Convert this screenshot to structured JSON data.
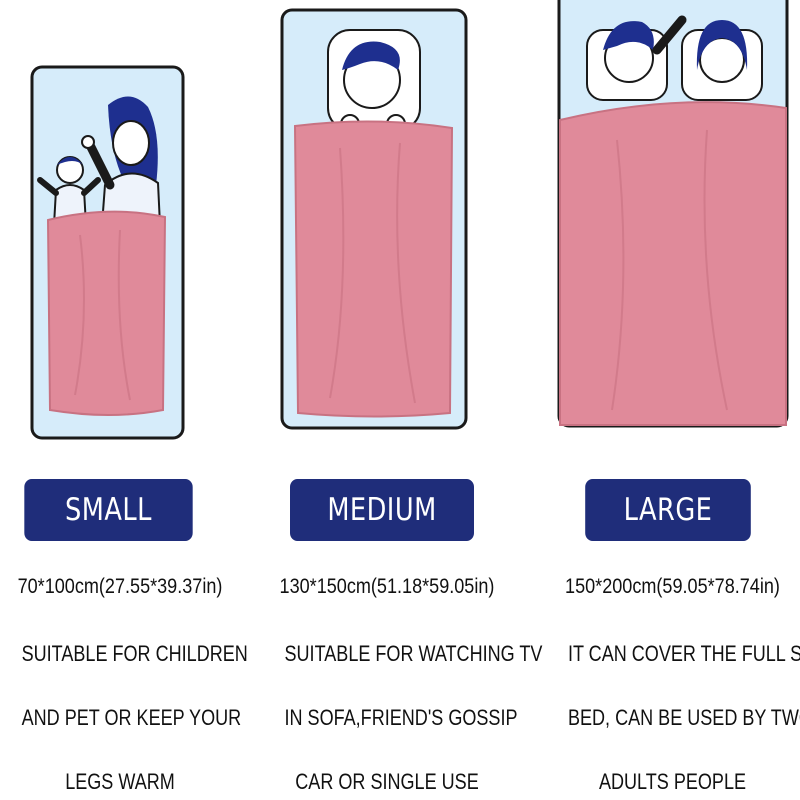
{
  "products": [
    {
      "id": "small",
      "label": "SMALL",
      "size": "70*100cm(27.55*39.37in)",
      "description": [
        "SUITABLE FOR CHILDREN",
        "AND PET OR KEEP YOUR",
        "LEGS WARM"
      ]
    },
    {
      "id": "medium",
      "label": "MEDIUM",
      "size": "130*150cm(51.18*59.05in)",
      "description": [
        "SUITABLE FOR WATCHING TV",
        "IN SOFA,FRIEND'S GOSSIP",
        "CAR OR SINGLE USE"
      ]
    },
    {
      "id": "large",
      "label": "LARGE",
      "size": "150*200cm(59.05*78.74in)",
      "description": [
        "IT CAN COVER THE FULL SIZE",
        "BED, CAN BE USED BY TWO",
        "ADULTS PEOPLE"
      ]
    }
  ],
  "colors": {
    "badge": "#1f2d7a",
    "blanket": "#e08a9a",
    "bed": "#d6ecfa",
    "hair": "#1e2f8f"
  },
  "icons": [
    "mother-child-illustration",
    "single-person-illustration",
    "couple-illustration"
  ]
}
